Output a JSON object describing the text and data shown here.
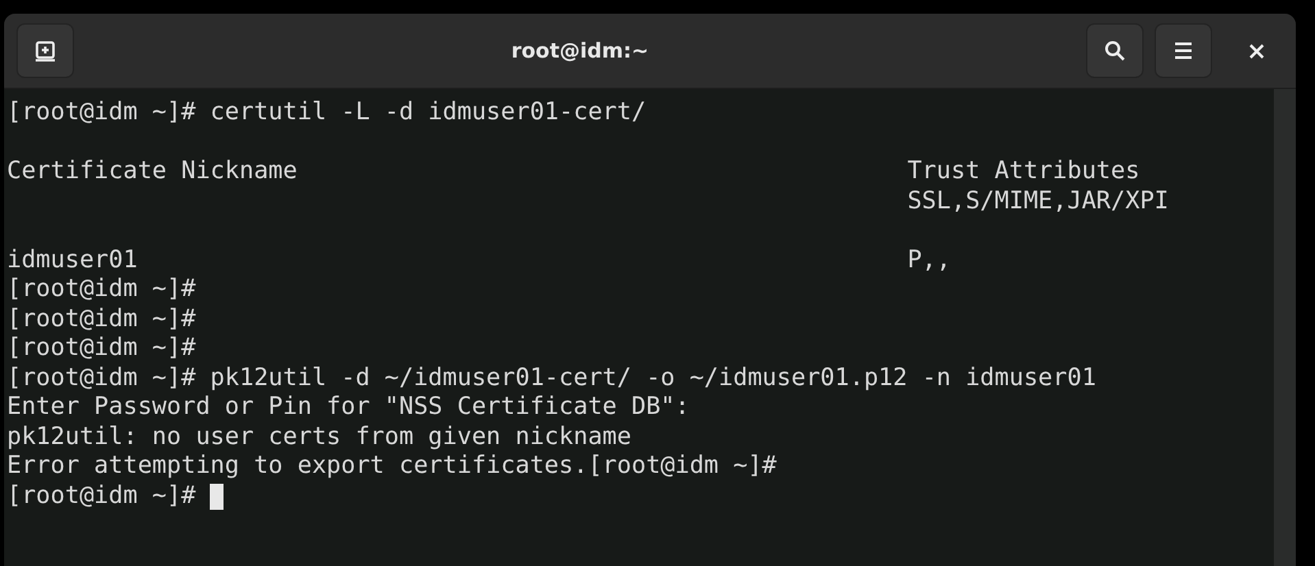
{
  "window": {
    "title": "root@idm:~"
  },
  "terminal": {
    "lines": [
      {
        "kind": "text",
        "text": "[root@idm ~]# certutil -L -d idmuser01-cert/"
      },
      {
        "kind": "blank"
      },
      {
        "kind": "row",
        "nickname": "Certificate Nickname",
        "trust": "Trust Attributes"
      },
      {
        "kind": "row",
        "trust": "SSL,S/MIME,JAR/XPI"
      },
      {
        "kind": "blank"
      },
      {
        "kind": "row",
        "nickname": "idmuser01",
        "trust": "P,,"
      },
      {
        "kind": "text",
        "text": "[root@idm ~]#"
      },
      {
        "kind": "text",
        "text": "[root@idm ~]#"
      },
      {
        "kind": "text",
        "text": "[root@idm ~]#"
      },
      {
        "kind": "text",
        "text": "[root@idm ~]# pk12util -d ~/idmuser01-cert/ -o ~/idmuser01.p12 -n idmuser01"
      },
      {
        "kind": "text",
        "text": "Enter Password or Pin for \"NSS Certificate DB\":"
      },
      {
        "kind": "text",
        "text": "pk12util: no user certs from given nickname"
      },
      {
        "kind": "text",
        "text": "Error attempting to export certificates.[root@idm ~]#"
      },
      {
        "kind": "prompt",
        "text": "[root@idm ~]#",
        "cursor": true
      }
    ]
  }
}
